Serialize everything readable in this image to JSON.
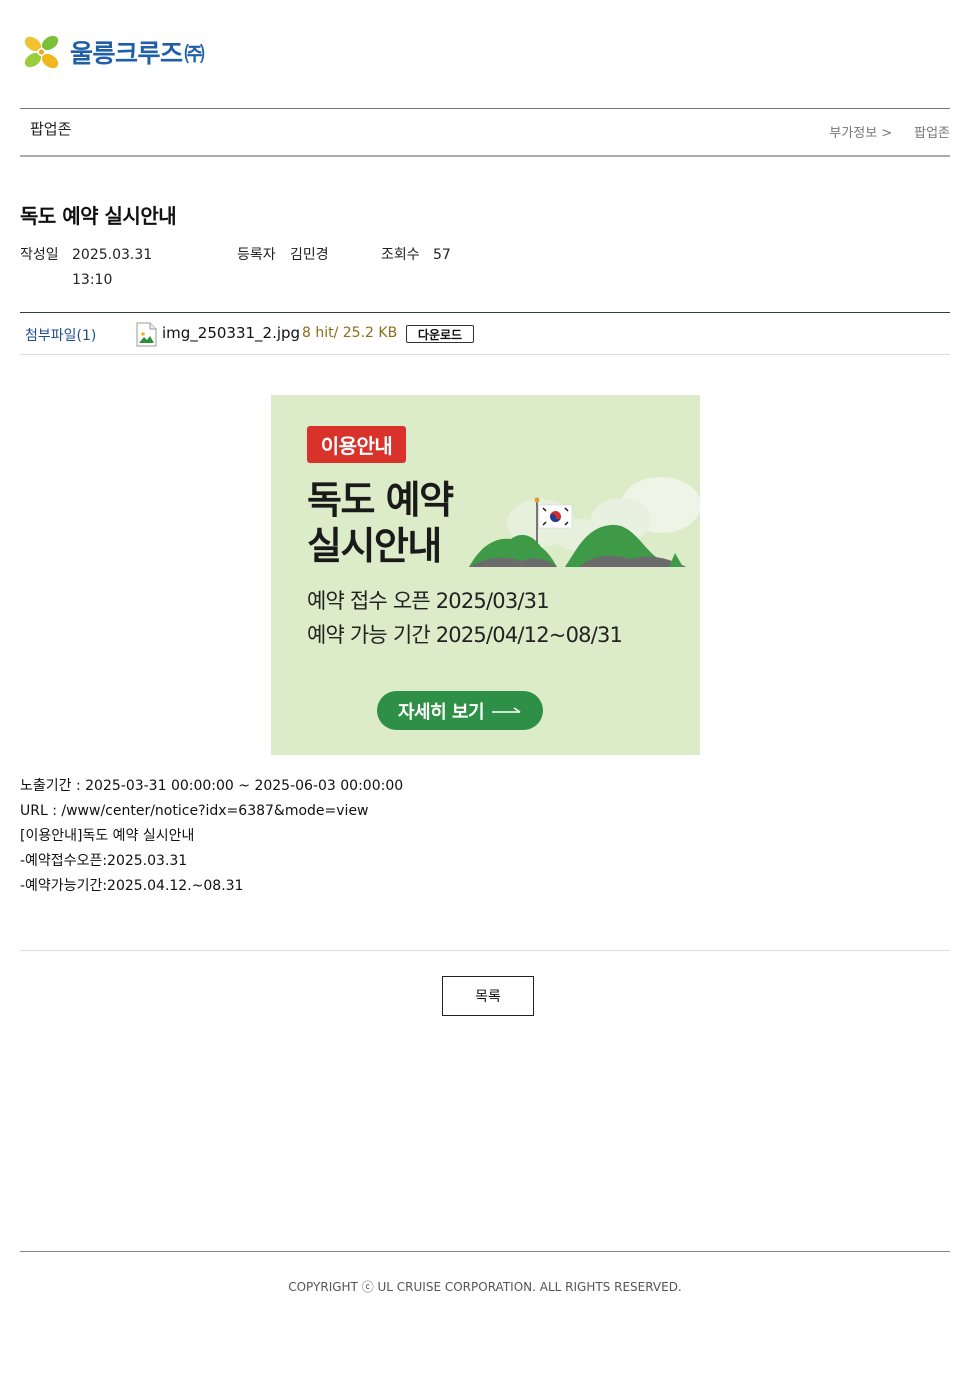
{
  "logo": {
    "name": "울릉크루즈",
    "suffix": "㈜"
  },
  "section": {
    "title": "팝업존",
    "breadcrumb": [
      "부가정보",
      "팝업존"
    ],
    "breadcrumb_sep": ">"
  },
  "post": {
    "title": "독도 예약 실시안내",
    "date_label": "작성일",
    "date": "2025.03.31",
    "time": "13:10",
    "author_label": "등록자",
    "author": "김민경",
    "views_label": "조회수",
    "views": "57"
  },
  "attachment": {
    "label": "첨부파일(1)",
    "file_name": "img_250331_2.jpg",
    "stats": "8 hit/ 25.2 KB",
    "download_label": "다운로드"
  },
  "banner": {
    "badge": "이용안내",
    "headline_1": "독도 예약",
    "headline_2": "실시안내",
    "line_1": "예약 접수 오픈 2025/03/31",
    "line_2": "예약 가능 기간 2025/04/12~08/31",
    "cta": "자세히 보기",
    "colors": {
      "background": "#dcecc9",
      "badge": "#d8322b",
      "cta": "#2e9046"
    }
  },
  "body": {
    "lines": [
      "노출기간 : 2025-03-31 00:00:00 ~ 2025-06-03 00:00:00",
      "URL : /www/center/notice?idx=6387&mode=view",
      "[이용안내]독도 예약 실시안내",
      "-예약접수오픈:2025.03.31",
      "-예약가능기간:2025.04.12.~08.31"
    ]
  },
  "list_button": "목록",
  "footer": "COPYRIGHT ⓒ UL CRUISE CORPORATION. ALL RIGHTS RESERVED."
}
